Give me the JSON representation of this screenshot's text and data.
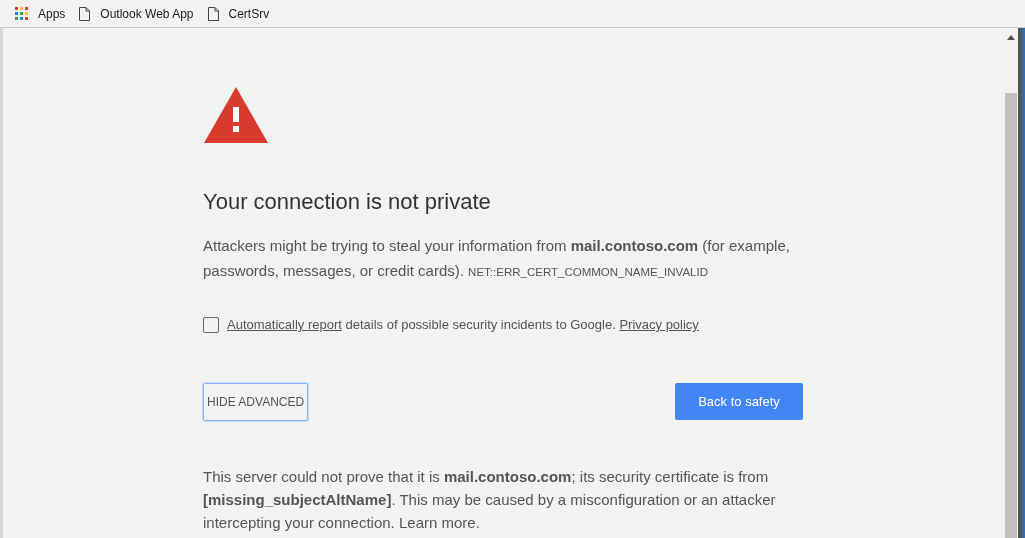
{
  "bookmarks": [
    {
      "kind": "apps",
      "label": "Apps"
    },
    {
      "kind": "page",
      "label": "Outlook Web App"
    },
    {
      "kind": "page",
      "label": "CertSrv"
    }
  ],
  "heading": "Your connection is not private",
  "intro": {
    "text": "Attackers might be trying to steal your information from **mail.contoso.com** (for example, passwords, messages, or credit cards).",
    "error_code": "NET::ERR_CERT_COMMON_NAME_INVALID"
  },
  "report": {
    "checked": false,
    "link": "Automatically report",
    "text": "details of possible security incidents to Google.",
    "policy_link": "Privacy policy"
  },
  "buttons": {
    "advanced": "HIDE ADVANCED",
    "safety": "Back to safety"
  },
  "details": {
    "text": "This server could not prove that it is **mail.contoso.com**; its security certificate is from **[missing_subjectAltName]**. This may be caused by a misconfiguration or an attacker intercepting your connection.",
    "link": "Learn more."
  }
}
